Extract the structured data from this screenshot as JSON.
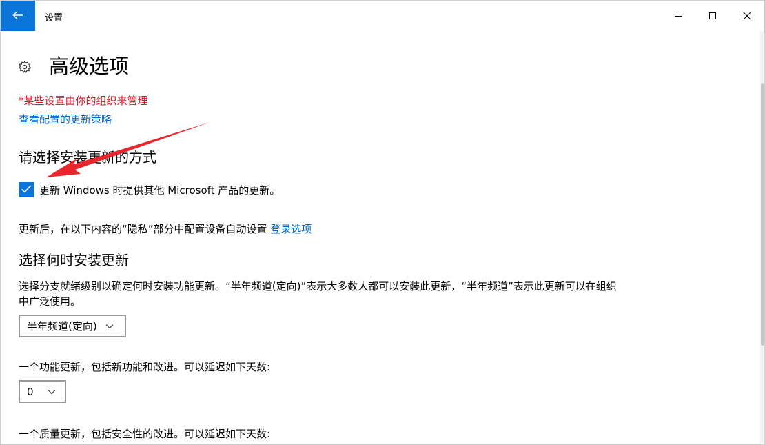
{
  "window": {
    "title": "设置"
  },
  "page": {
    "title": "高级选项",
    "warning": "*某些设置由你的组织来管理",
    "policy_link": "查看配置的更新策略"
  },
  "install_section": {
    "heading": "请选择安装更新的方式",
    "checkbox_label": "更新 Windows 时提供其他 Microsoft 产品的更新。",
    "checkbox_checked": true,
    "privacy_text": "更新后，在以下内容的“隐私”部分中配置设备自动设置",
    "privacy_link": "登录选项"
  },
  "when_section": {
    "heading": "选择何时安装更新",
    "description": "选择分支就绪级别以确定何时安装功能更新。“半年频道(定向)”表示大多数人都可以安装此更新，“半年频道”表示此更新可以在组织中广泛使用。",
    "channel_select": "半年频道(定向)",
    "feature_defer_label": "一个功能更新，包括新功能和改进。可以延迟如下天数:",
    "feature_defer_value": "0",
    "quality_defer_label": "一个质量更新，包括安全性的改进。可以延迟如下天数:"
  },
  "colors": {
    "accent": "#0a74d8",
    "warning": "#e81123",
    "link": "#0066cc",
    "annotation_arrow": "#e8262d"
  },
  "icons": {
    "back": "arrow-left-icon",
    "settings": "gear-icon",
    "minimize": "minimize-icon",
    "maximize": "maximize-icon",
    "close": "close-icon",
    "checkbox": "checkmark-icon",
    "dropdown": "chevron-down-icon"
  }
}
